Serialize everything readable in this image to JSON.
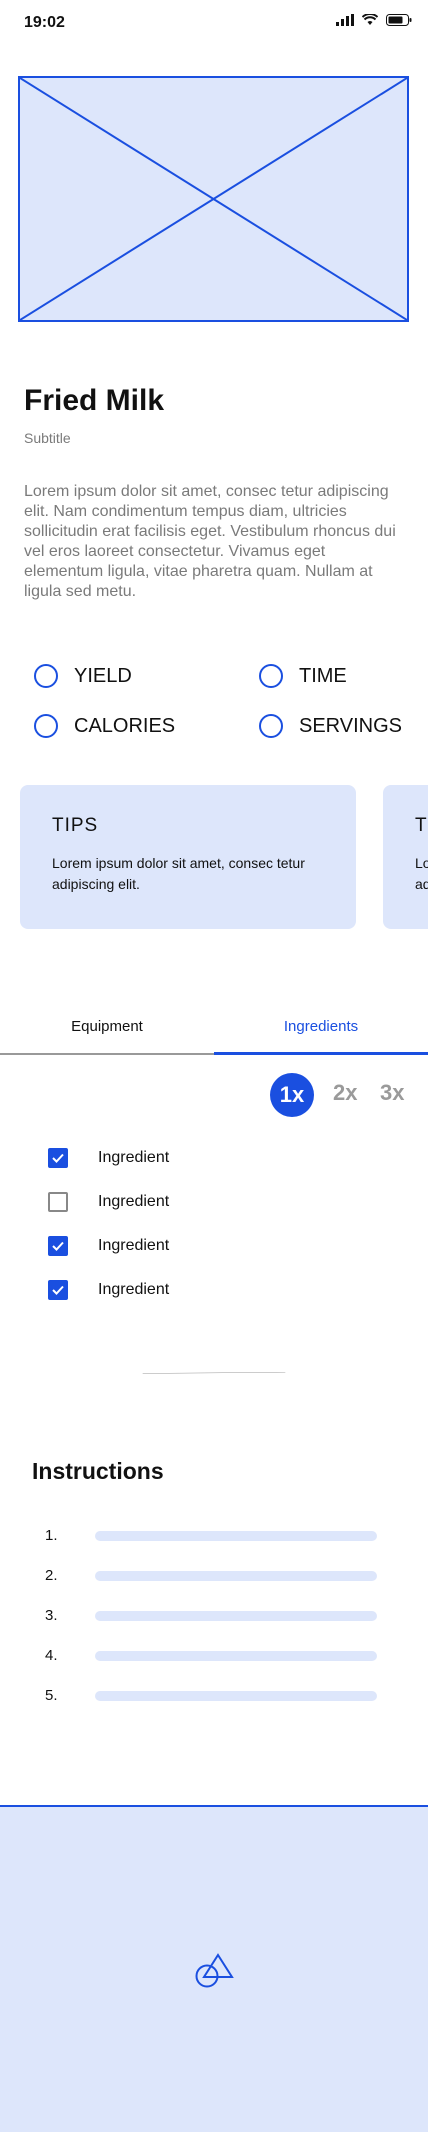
{
  "status_bar": {
    "time": "19:02"
  },
  "recipe": {
    "title": "Fried Milk",
    "subtitle": "Subtitle",
    "description": "Lorem ipsum dolor sit amet, consec tetur adipiscing elit. Nam condimentum tempus diam, ultricies sollicitudin erat facilisis eget. Vestibulum rhoncus dui vel eros laoreet consectetur. Vivamus eget elementum ligula, vitae pharetra quam. Nullam at ligula sed metu."
  },
  "stats": [
    {
      "label": "YIELD"
    },
    {
      "label": "TIME"
    },
    {
      "label": "CALORIES"
    },
    {
      "label": "SERVINGS"
    }
  ],
  "tips": [
    {
      "title": "TIPS",
      "body": "Lorem ipsum dolor sit amet, consec tetur adipiscing elit."
    },
    {
      "title": "TIPS",
      "body": "Lorem ipsum dolor sit amet, consec tetur adipiscing elit."
    }
  ],
  "tabs": [
    {
      "label": "Equipment",
      "active": false
    },
    {
      "label": "Ingredients",
      "active": true
    }
  ],
  "scale": {
    "options": [
      "1x",
      "2x",
      "3x"
    ],
    "selected": "1x"
  },
  "ingredients": [
    {
      "label": "Ingredient",
      "checked": true
    },
    {
      "label": "Ingredient",
      "checked": false
    },
    {
      "label": "Ingredient",
      "checked": true
    },
    {
      "label": "Ingredient",
      "checked": true
    }
  ],
  "instructions": {
    "title": "Instructions",
    "steps": [
      "1.",
      "2.",
      "3.",
      "4.",
      "5."
    ]
  },
  "colors": {
    "accent": "#1a4fe0",
    "placeholder": "#dde6fb",
    "muted_text": "#7a7a7a"
  }
}
